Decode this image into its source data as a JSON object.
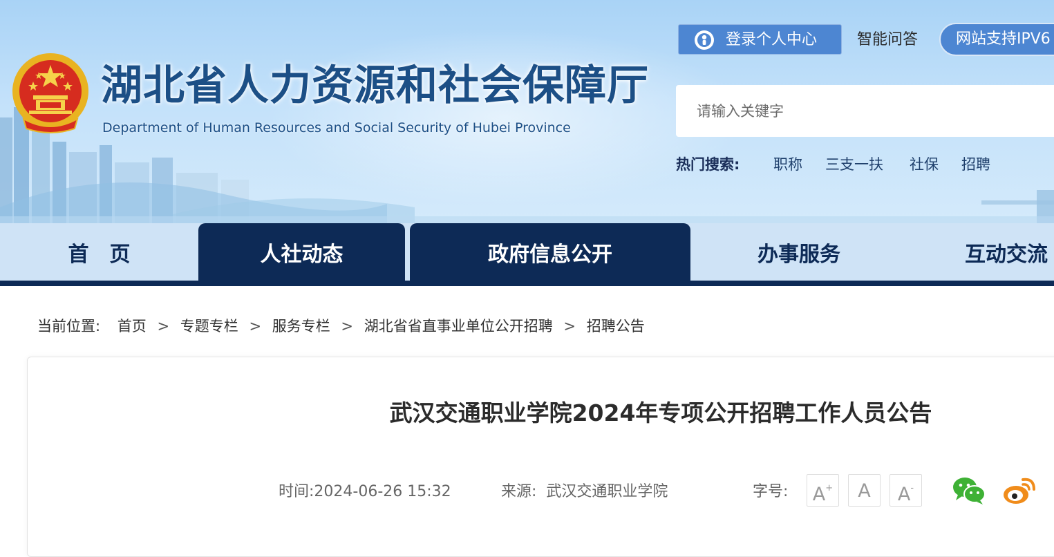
{
  "header": {
    "title_cn": "湖北省人力资源和社会保障厅",
    "title_en": "Department of Human Resources and Social Security of Hubei Province",
    "login_label": "登录个人中心",
    "qa_label": "智能问答",
    "ipv6_label": "网站支持IPV6"
  },
  "search": {
    "placeholder": "请输入关键字",
    "hot_label": "热门搜索:",
    "hot_terms": [
      "职称",
      "三支一扶",
      "社保",
      "招聘"
    ]
  },
  "nav": {
    "items": [
      {
        "label": "首　页",
        "active": false
      },
      {
        "label": "人社动态",
        "active": true
      },
      {
        "label": "政府信息公开",
        "active": true
      },
      {
        "label": "办事服务",
        "active": false
      },
      {
        "label": "互动交流",
        "active": false
      }
    ]
  },
  "breadcrumb": {
    "prefix": "当前位置:",
    "items": [
      "首页",
      "专题专栏",
      "服务专栏",
      "湖北省省直事业单位公开招聘",
      "招聘公告"
    ],
    "separator": ">"
  },
  "article": {
    "title": "武汉交通职业学院2024年专项公开招聘工作人员公告",
    "time_label": "时间:",
    "time_value": "2024-06-26 15:32",
    "source_label": "来源:",
    "source_value": "武汉交通职业学院",
    "font_size_label": "字号:",
    "font_buttons": [
      "A+",
      "A",
      "A-"
    ]
  },
  "colors": {
    "primary_navy": "#0d2a56",
    "login_blue": "#4d86d2",
    "title_blue": "#1c4f86",
    "wechat_green": "#3eb135",
    "weibo_orange": "#f08c1b"
  },
  "icons": {
    "emblem": "national-emblem",
    "login": "user-icon",
    "share": [
      "wechat-icon",
      "weibo-icon"
    ]
  }
}
